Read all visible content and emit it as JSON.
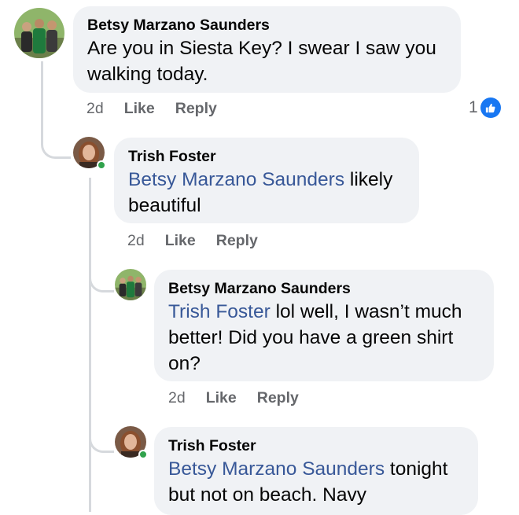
{
  "comments": [
    {
      "author": "Betsy Marzano Saunders",
      "mention": "",
      "text": "Are you in Siesta Key? I swear I saw you walking today.",
      "time": "2d",
      "like": "Like",
      "reply": "Reply",
      "reaction_count": "1"
    },
    {
      "author": "Trish Foster",
      "mention": "Betsy Marzano Saunders",
      "text": " likely beautiful",
      "time": "2d",
      "like": "Like",
      "reply": "Reply"
    },
    {
      "author": "Betsy Marzano Saunders",
      "mention": "Trish Foster",
      "text": " lol well, I wasn’t much better! Did you have a green shirt on?",
      "time": "2d",
      "like": "Like",
      "reply": "Reply"
    },
    {
      "author": "Trish Foster",
      "mention": "Betsy Marzano Saunders",
      "text": " tonight but not on beach. Navy"
    }
  ],
  "colors": {
    "bubble": "#f0f2f5",
    "mention": "#385898",
    "meta": "#65676b",
    "like_badge": "#1877f2",
    "online": "#31a24c",
    "thread_line": "#d6d9dd"
  },
  "icons": {
    "reaction": "thumbs-up-icon",
    "online": "online-status-dot"
  }
}
